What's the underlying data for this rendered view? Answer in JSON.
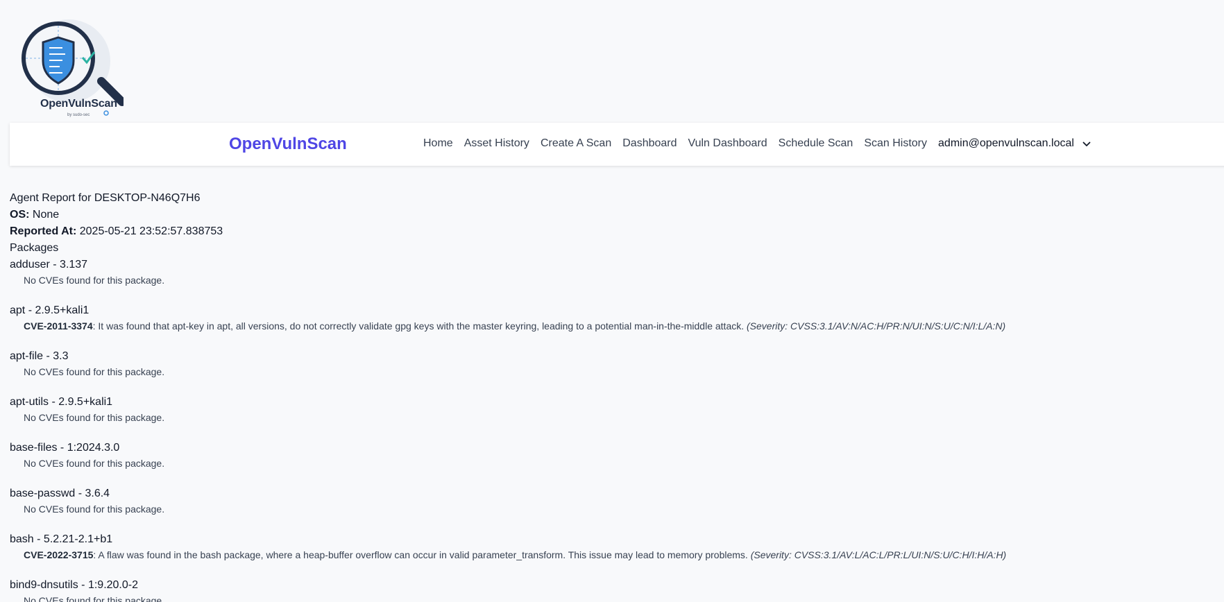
{
  "logo": {
    "title": "OpenVulnScan",
    "subtitle": "by sudo-sec"
  },
  "navbar": {
    "brand": "OpenVulnScan",
    "links": [
      "Home",
      "Asset History",
      "Create A Scan",
      "Dashboard",
      "Vuln Dashboard",
      "Schedule Scan",
      "Scan History"
    ],
    "user": "admin@openvulnscan.local"
  },
  "report": {
    "title": "Agent Report for DESKTOP-N46Q7H6",
    "os_label": "OS:",
    "os_value": "None",
    "reported_label": "Reported At:",
    "reported_value": "2025-05-21 23:52:57.838753",
    "packages_heading": "Packages",
    "packages": [
      {
        "name": "adduser - 3.137",
        "no_cve": "No CVEs found for this package."
      },
      {
        "name": "apt - 2.9.5+kali1",
        "cve_id": "CVE-2011-3374",
        "cve_desc": ": It was found that apt-key in apt, all versions, do not correctly validate gpg keys with the master keyring, leading to a potential man-in-the-middle attack. ",
        "severity": "(Severity: CVSS:3.1/AV:N/AC:H/PR:N/UI:N/S:U/C:N/I:L/A:N)"
      },
      {
        "name": "apt-file - 3.3",
        "no_cve": "No CVEs found for this package."
      },
      {
        "name": "apt-utils - 2.9.5+kali1",
        "no_cve": "No CVEs found for this package."
      },
      {
        "name": "base-files - 1:2024.3.0",
        "no_cve": "No CVEs found for this package."
      },
      {
        "name": "base-passwd - 3.6.4",
        "no_cve": "No CVEs found for this package."
      },
      {
        "name": "bash - 5.2.21-2.1+b1",
        "cve_id": "CVE-2022-3715",
        "cve_desc": ": A flaw was found in the bash package, where a heap-buffer overflow can occur in valid parameter_transform. This issue may lead to memory problems. ",
        "severity": "(Severity: CVSS:3.1/AV:L/AC:L/PR:L/UI:N/S:U/C:H/I:H/A:H)"
      },
      {
        "name": "bind9-dnsutils - 1:9.20.0-2",
        "no_cve": "No CVEs found for this package."
      }
    ]
  },
  "colors": {
    "brand": "#4f46e5",
    "logo_navy": "#223049",
    "shield_blue": "#3b8fe0",
    "check_teal": "#2bb3a3"
  },
  "icons": {
    "logo": "magnifier-shield-icon",
    "user_menu": "chevron-down-icon"
  }
}
